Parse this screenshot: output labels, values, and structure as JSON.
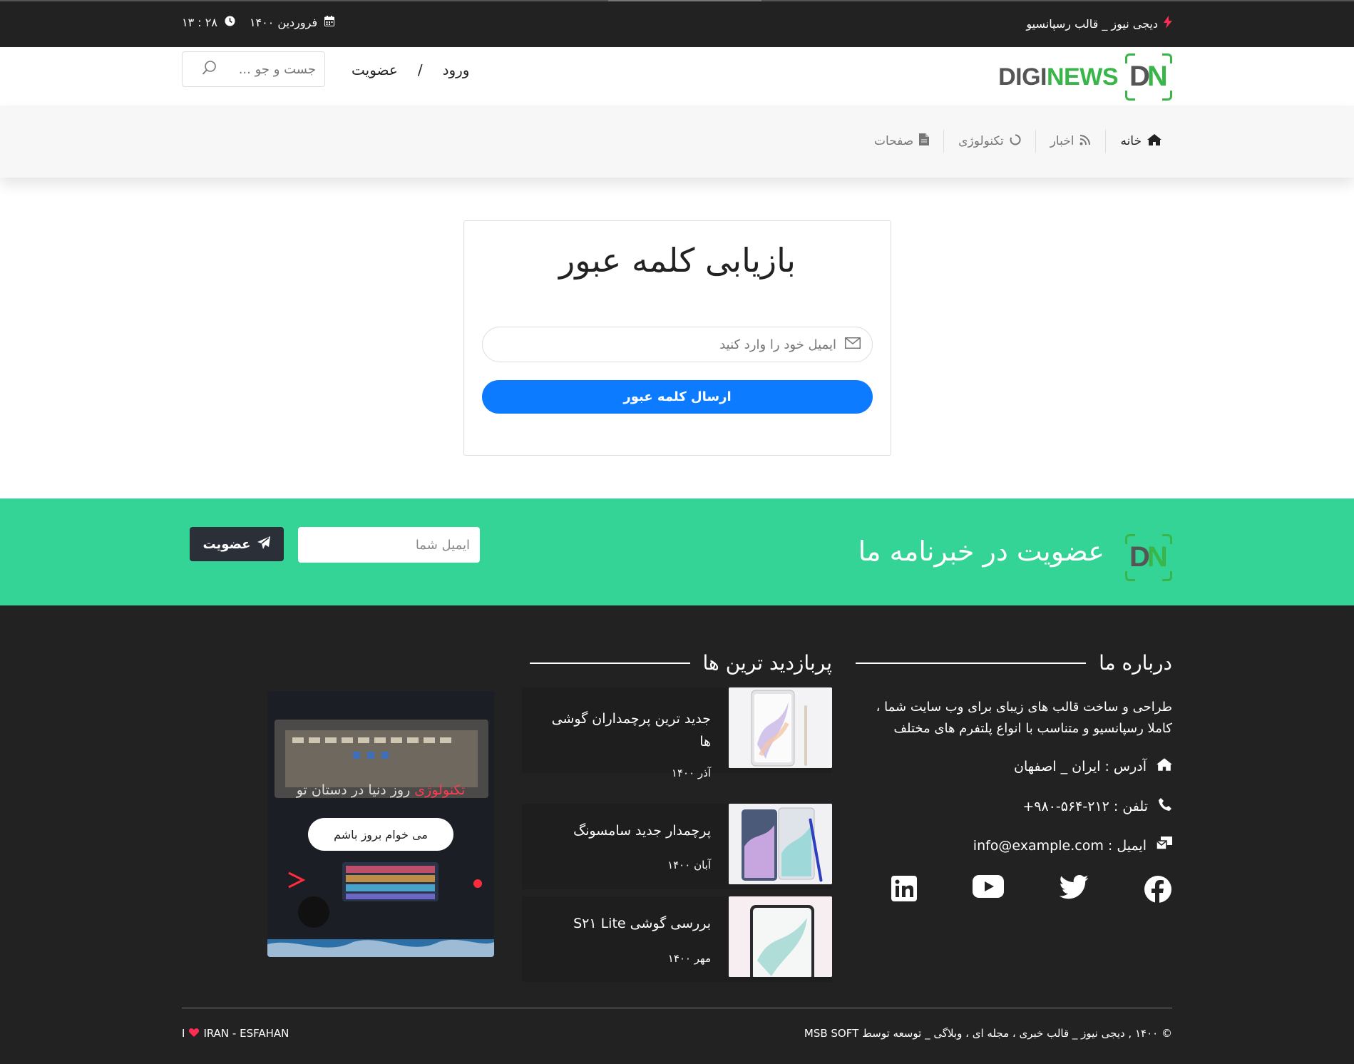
{
  "topbar": {
    "site_tagline": "دیجی نیوز _ قالب رسپانسیو",
    "date": "فروردین ۱۴۰۰",
    "time": "۲۸ : ۱۳"
  },
  "header": {
    "logo_text_1": "DIGI",
    "logo_text_2": "NEWS",
    "logo_mark_1": "D",
    "logo_mark_2": "N",
    "login_label": "ورود",
    "separator": "/",
    "register_label": "عضویت",
    "search_placeholder": "جست و جو ..."
  },
  "nav": {
    "items": [
      {
        "label": "خانه",
        "icon": "home-icon"
      },
      {
        "label": "اخبار",
        "icon": "rss-icon"
      },
      {
        "label": "تکنولوژی",
        "icon": "spinner-icon"
      },
      {
        "label": "صفحات",
        "icon": "file-icon"
      }
    ]
  },
  "recovery": {
    "title": "بازیابی کلمه عبور",
    "email_placeholder": "ایمیل خود را وارد کنید",
    "submit_label": "ارسال کلمه عبور"
  },
  "newsletter": {
    "title": "عضویت در خبرنامه ما",
    "email_placeholder": "ایمیل شما",
    "button_label": "عضویت"
  },
  "footer": {
    "about": {
      "title": "درباره ما",
      "text": "طراحی و ساخت قالب های زیبای برای وب سایت شما ، کاملا رسپانسیو و متناسب با انواع پلتفرم های مختلف",
      "address": "آدرس : ایران _ اصفهان",
      "phone": "تلفن : ۲۱۲-۵۶۴-۹۸۰+",
      "email": "ایمیل : info@example.com"
    },
    "popular": {
      "title": "پربازدید ترین ها",
      "posts": [
        {
          "title": "جدید ترین پرچمداران گوشی ها",
          "date": "آذر ۱۴۰۰"
        },
        {
          "title": "پرچمدار جدید سامسونگ",
          "date": "آبان ۱۴۰۰"
        },
        {
          "title": "بررسی گوشی S۲۱ Lite",
          "date": "مهر ۱۴۰۰"
        }
      ]
    },
    "promo": {
      "highlight": "تکنولوژی",
      "text": " روز دنیا در دستان تو",
      "button": "می خوام بروز باشم"
    },
    "copyright": "© ۱۴۰۰ , دیجی نیوز _ قالب خبری ، مجله ای ، وبلاگی _ توسعه توسط MSB SOFT",
    "location": "IRAN - ESFAHAN",
    "location_prefix": "I"
  },
  "colors": {
    "accent_blue": "#0d7bff",
    "newsletter_green": "#34d496",
    "brand_green": "#3ab54a",
    "dark": "#222222",
    "highlight_red": "#ff3b4f"
  }
}
